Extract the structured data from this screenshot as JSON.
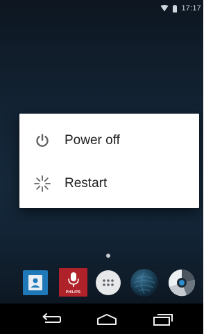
{
  "status_bar": {
    "time": "17:17",
    "icons": [
      "wifi-icon",
      "battery-icon"
    ]
  },
  "power_menu": {
    "items": [
      {
        "label": "Power off",
        "icon": "power-icon"
      },
      {
        "label": "Restart",
        "icon": "restart-spinner-icon"
      }
    ]
  },
  "home_screen": {
    "page_indicator": {
      "pages": 1,
      "current": 1
    },
    "dock": [
      {
        "icon": "contacts-icon",
        "color": "#1f79b8"
      },
      {
        "icon": "philips-microphone-app-icon",
        "label": "PHILIPS",
        "color": "#b0222a"
      },
      {
        "icon": "app-drawer-icon",
        "color": "#e6e8ea"
      },
      {
        "icon": "globe-app-icon"
      },
      {
        "icon": "camera-app-icon"
      }
    ]
  },
  "nav_bar": {
    "buttons": [
      "back-icon",
      "home-icon",
      "recent-apps-icon"
    ]
  },
  "colors": {
    "dialog_background": "#ffffff",
    "dialog_text": "#212121",
    "icon_gray": "#616161",
    "nav_bar": "#000000"
  }
}
